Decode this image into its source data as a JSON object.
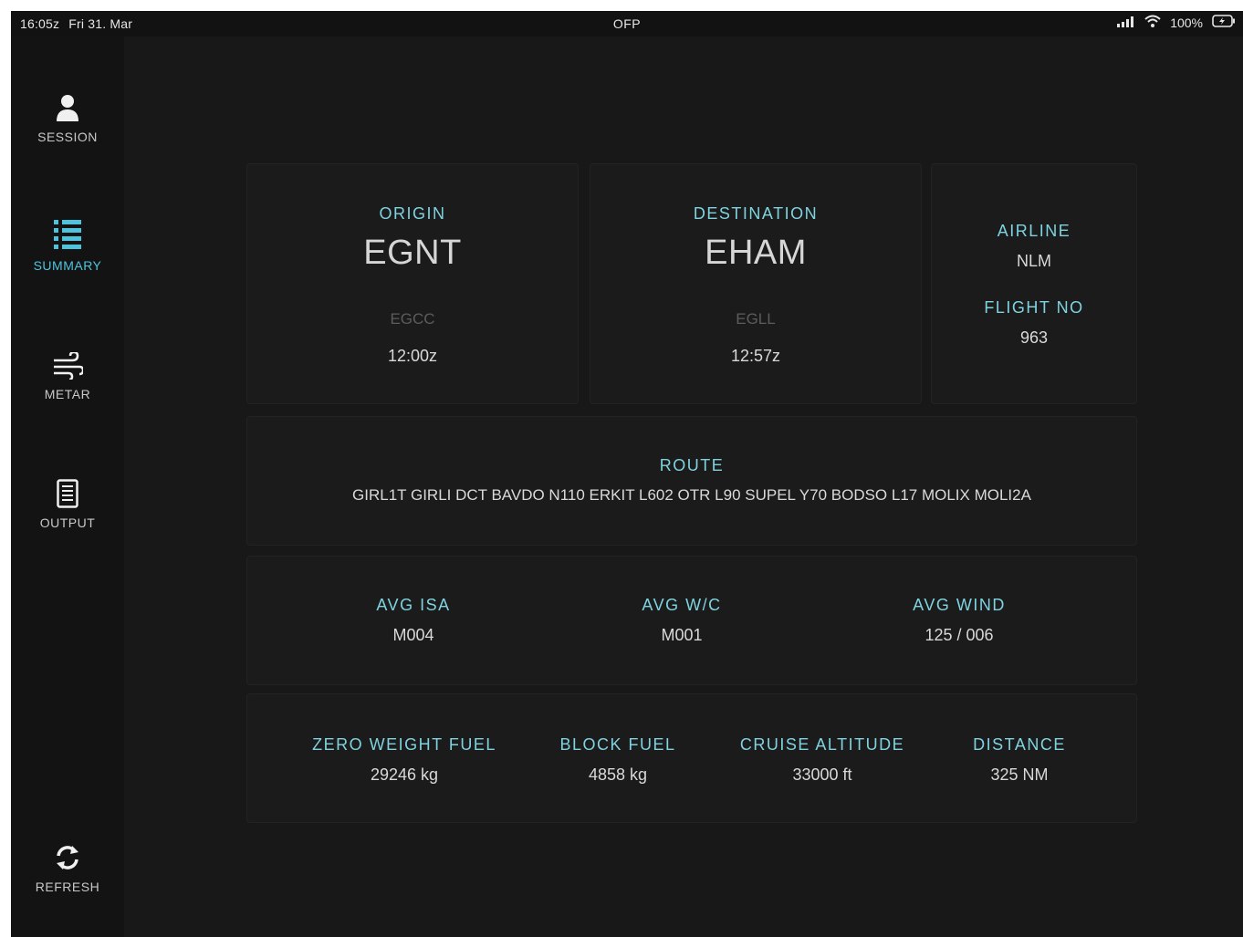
{
  "status_bar": {
    "time": "16:05z",
    "date": "Fri 31. Mar",
    "title": "OFP",
    "battery": "100%"
  },
  "sidebar": {
    "items": [
      {
        "label": "SESSION",
        "icon": "person-icon",
        "active": false
      },
      {
        "label": "SUMMARY",
        "icon": "list-icon",
        "active": true
      },
      {
        "label": "METAR",
        "icon": "wind-icon",
        "active": false
      },
      {
        "label": "OUTPUT",
        "icon": "document-icon",
        "active": false
      }
    ],
    "refresh": {
      "label": "REFRESH",
      "icon": "refresh-icon"
    }
  },
  "origin": {
    "label": "ORIGIN",
    "code": "EGNT",
    "alternate": "EGCC",
    "time": "12:00z"
  },
  "destination": {
    "label": "DESTINATION",
    "code": "EHAM",
    "alternate": "EGLL",
    "time": "12:57z"
  },
  "airline": {
    "label": "AIRLINE",
    "value": "NLM"
  },
  "flight": {
    "label": "FLIGHT NO",
    "value": "963"
  },
  "route": {
    "label": "ROUTE",
    "value": "GIRL1T GIRLI DCT BAVDO N110 ERKIT L602 OTR L90 SUPEL Y70 BODSO L17 MOLIX MOLI2A"
  },
  "weather": [
    {
      "label": "AVG ISA",
      "value": "M004"
    },
    {
      "label": "AVG W/C",
      "value": "M001"
    },
    {
      "label": "AVG WIND",
      "value": "125 / 006"
    }
  ],
  "fuel": [
    {
      "label": "ZERO WEIGHT FUEL",
      "value": "29246 kg"
    },
    {
      "label": "BLOCK FUEL",
      "value": "4858 kg"
    },
    {
      "label": "CRUISE ALTITUDE",
      "value": "33000 ft"
    },
    {
      "label": "DISTANCE",
      "value": "325 NM"
    }
  ],
  "colors": {
    "accent": "#4fc3dc",
    "label": "#7fd3e0",
    "background": "#181818",
    "sidebar": "#131313"
  }
}
